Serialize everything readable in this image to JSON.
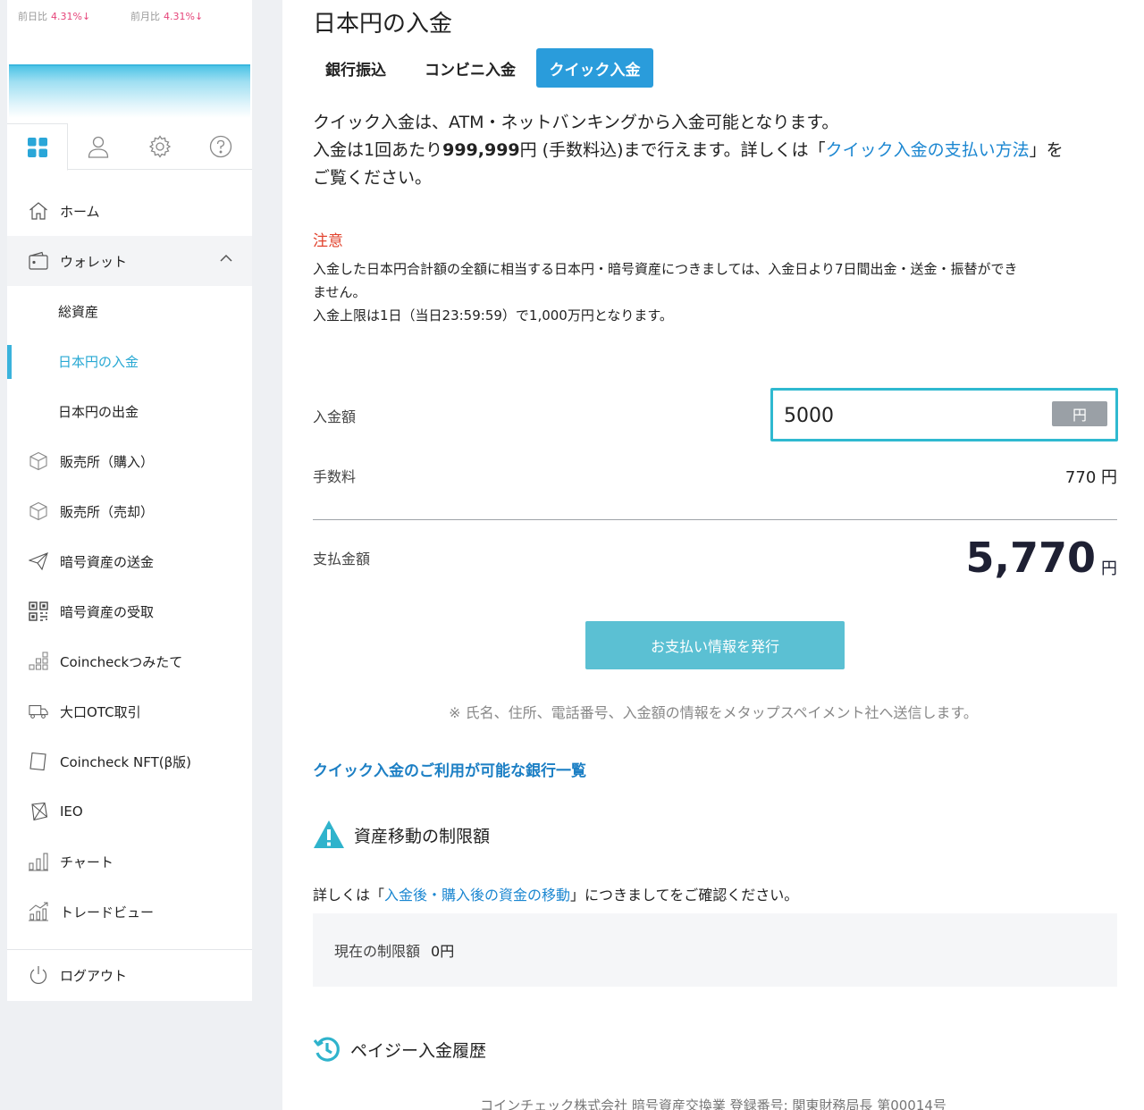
{
  "ticker": {
    "day_label": "前日比",
    "day_value": "4.31%↓",
    "month_label": "前月比",
    "month_value": "4.31%↓"
  },
  "sidebar": {
    "items": [
      {
        "label": "ホーム"
      },
      {
        "label": "ウォレット"
      },
      {
        "label": "総資産"
      },
      {
        "label": "日本円の入金"
      },
      {
        "label": "日本円の出金"
      },
      {
        "label": "販売所（購入）"
      },
      {
        "label": "販売所（売却）"
      },
      {
        "label": "暗号資産の送金"
      },
      {
        "label": "暗号資産の受取"
      },
      {
        "label": "Coincheckつみたて"
      },
      {
        "label": "大口OTC取引"
      },
      {
        "label": "Coincheck NFT(β版)"
      },
      {
        "label": "IEO"
      },
      {
        "label": "チャート"
      },
      {
        "label": "トレードビュー"
      }
    ],
    "logout_label": "ログアウト"
  },
  "main": {
    "title": "日本円の入金",
    "tabs": [
      {
        "label": "銀行振込"
      },
      {
        "label": "コンビニ入金"
      },
      {
        "label": "クイック入金"
      }
    ],
    "intro_line1": "クイック入金は、ATM・ネットバンキングから入金可能となります。",
    "intro_line2_pre": "入金は1回あたり",
    "intro_line2_amount": "999,999",
    "intro_line2_mid": "円 (手数料込)まで行えます。詳しくは「",
    "intro_link": "クイック入金の支払い方法",
    "intro_line2_post": "」を",
    "intro_line3": "ご覧ください。",
    "caution_title": "注意",
    "caution_line1": "入金した日本円合計額の全額に相当する日本円・暗号資産につきましては、入金日より7日間出金・送金・振替ができ",
    "caution_line2": "ません。",
    "caution_line3": "入金上限は1日（当日23:59:59）で1,000万円となります。",
    "amount_label": "入金額",
    "amount_value": "5000",
    "amount_unit": "円",
    "fee_label": "手数料",
    "fee_value": "770 円",
    "total_label": "支払金額",
    "total_value": "5,770",
    "total_unit": "円",
    "issue_button": "お支払い情報を発行",
    "note": "※ 氏名、住所、電話番号、入金額の情報をメタップスペイメント社へ送信します。",
    "bank_list_link": "クイック入金のご利用が可能な銀行一覧",
    "limit_title": "資産移動の制限額",
    "limit_text_pre": "詳しくは「",
    "limit_link": "入金後・購入後の資金の移動",
    "limit_text_post": "」につきましてをご確認ください。",
    "current_limit_label": "現在の制限額",
    "current_limit_value": "0円",
    "history_title": "ペイジー入金履歴",
    "footer": "コインチェック株式会社 暗号資産交換業 登録番号: 関東財務局長 第00014号"
  },
  "colors": {
    "accent": "#2a9cdb",
    "button": "#5bc0d3",
    "caution": "#e2442f",
    "link": "#1c87d1",
    "input_border": "#2fb9d0"
  }
}
